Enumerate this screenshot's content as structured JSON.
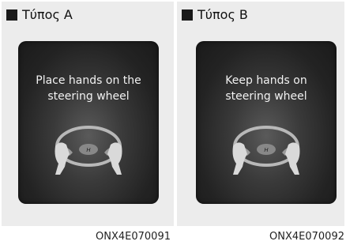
{
  "panels": [
    {
      "label": "Τύπος A",
      "message": "Place hands on the\nsteering wheel",
      "caption": "ONX4E070091"
    },
    {
      "label": "Τύπος B",
      "message": "Keep hands on\nsteering wheel",
      "caption": "ONX4E070092"
    }
  ],
  "colors": {
    "panel_bg": "#ececec",
    "display_bg": "#1f1f1f",
    "text_light": "#f2f2f2"
  },
  "icons": [
    "square-bullet-icon",
    "steering-wheel-with-hands-icon"
  ]
}
